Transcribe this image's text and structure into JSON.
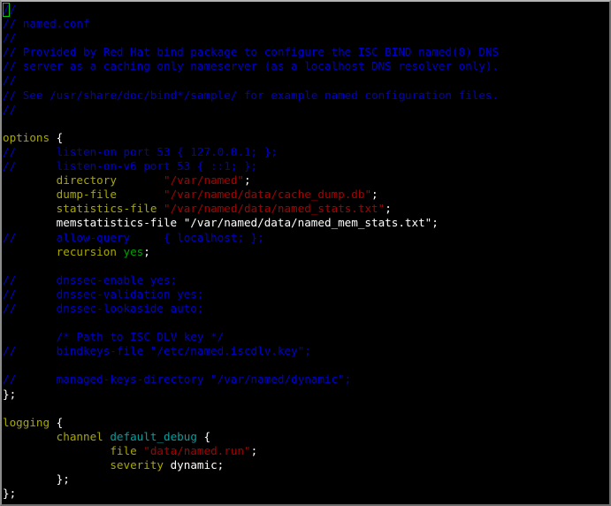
{
  "window": {
    "app": "terminal",
    "background_color": "#000000",
    "border_color": "#b4b4b4"
  },
  "editor": {
    "filename": "named.conf",
    "mode": "normal",
    "cursor": {
      "line": 1,
      "column": 1,
      "char": "/",
      "color": "#00cc00"
    },
    "palette": {
      "plain": "#ffffff",
      "comment": "#0000cc",
      "keyword": "#a8a800",
      "string": "#a80000",
      "identifier": "#00a0a0",
      "value": "#00a000"
    }
  },
  "lines": [
    {
      "id": 1,
      "text": "//",
      "tokens": [
        {
          "t": "//",
          "c": "comment",
          "cursor": true
        }
      ]
    },
    {
      "id": 2,
      "text": "// named.conf",
      "tokens": [
        {
          "t": "// named.conf",
          "c": "comment"
        }
      ]
    },
    {
      "id": 3,
      "text": "//",
      "tokens": [
        {
          "t": "//",
          "c": "comment"
        }
      ]
    },
    {
      "id": 4,
      "text": "// Provided by Red Hat bind package to configure the ISC BIND named(8) DNS",
      "tokens": [
        {
          "t": "// Provided by Red Hat bind package to configure the ISC BIND named(8) DNS",
          "c": "comment"
        }
      ]
    },
    {
      "id": 5,
      "text": "// server as a caching only nameserver (as a localhost DNS resolver only).",
      "tokens": [
        {
          "t": "// server as a caching only nameserver (as a localhost DNS resolver only).",
          "c": "comment"
        }
      ]
    },
    {
      "id": 6,
      "text": "//",
      "tokens": [
        {
          "t": "//",
          "c": "comment"
        }
      ]
    },
    {
      "id": 7,
      "text": "// See /usr/share/doc/bind*/sample/ for example named configuration files.",
      "tokens": [
        {
          "t": "// See /usr/share/doc/bind*/sample/ for example named configuration files.",
          "c": "comment"
        }
      ]
    },
    {
      "id": 8,
      "text": "//",
      "tokens": [
        {
          "t": "//",
          "c": "comment"
        }
      ]
    },
    {
      "id": 9,
      "text": "",
      "tokens": []
    },
    {
      "id": 10,
      "text": "options {",
      "tokens": [
        {
          "t": "options",
          "c": "keyword"
        },
        {
          "t": " {",
          "c": "plain"
        }
      ]
    },
    {
      "id": 11,
      "text": "//\tlisten-on port 53 { 127.0.0.1; };",
      "tokens": [
        {
          "t": "//      listen-on port 53 { 127.0.0.1; };",
          "c": "comment"
        }
      ]
    },
    {
      "id": 12,
      "text": "//\tlisten-on-v6 port 53 { ::1; };",
      "tokens": [
        {
          "t": "//      listen-on-v6 port 53 { ::1; };",
          "c": "comment"
        }
      ]
    },
    {
      "id": 13,
      "text": "\tdirectory\t\"/var/named\";",
      "tokens": [
        {
          "t": "        ",
          "c": "plain"
        },
        {
          "t": "directory",
          "c": "keyword"
        },
        {
          "t": "       ",
          "c": "plain"
        },
        {
          "t": "\"/var/named\"",
          "c": "string"
        },
        {
          "t": ";",
          "c": "plain"
        }
      ]
    },
    {
      "id": 14,
      "text": "\tdump-file\t\"/var/named/data/cache_dump.db\";",
      "tokens": [
        {
          "t": "        ",
          "c": "plain"
        },
        {
          "t": "dump-file",
          "c": "keyword"
        },
        {
          "t": "       ",
          "c": "plain"
        },
        {
          "t": "\"/var/named/data/cache_dump.db\"",
          "c": "string"
        },
        {
          "t": ";",
          "c": "plain"
        }
      ]
    },
    {
      "id": 15,
      "text": "\tstatistics-file \"/var/named/data/named_stats.txt\";",
      "tokens": [
        {
          "t": "        ",
          "c": "plain"
        },
        {
          "t": "statistics-file",
          "c": "keyword"
        },
        {
          "t": " ",
          "c": "plain"
        },
        {
          "t": "\"/var/named/data/named_stats.txt\"",
          "c": "string"
        },
        {
          "t": ";",
          "c": "plain"
        }
      ]
    },
    {
      "id": 16,
      "text": "\tmemstatistics-file \"/var/named/data/named_mem_stats.txt\";",
      "tokens": [
        {
          "t": "        memstatistics-file \"/var/named/data/named_mem_stats.txt\";",
          "c": "plain"
        }
      ]
    },
    {
      "id": 17,
      "text": "//\tallow-query     { localhost; };",
      "tokens": [
        {
          "t": "//      allow-query     { localhost; };",
          "c": "comment"
        }
      ]
    },
    {
      "id": 18,
      "text": "\trecursion yes;",
      "tokens": [
        {
          "t": "        ",
          "c": "plain"
        },
        {
          "t": "recursion",
          "c": "keyword"
        },
        {
          "t": " ",
          "c": "plain"
        },
        {
          "t": "yes",
          "c": "value"
        },
        {
          "t": ";",
          "c": "plain"
        }
      ]
    },
    {
      "id": 19,
      "text": "",
      "tokens": []
    },
    {
      "id": 20,
      "text": "//\tdnssec-enable yes;",
      "tokens": [
        {
          "t": "//      dnssec-enable yes;",
          "c": "comment"
        }
      ]
    },
    {
      "id": 21,
      "text": "//\tdnssec-validation yes;",
      "tokens": [
        {
          "t": "//      dnssec-validation yes;",
          "c": "comment"
        }
      ]
    },
    {
      "id": 22,
      "text": "//\tdnssec-lookaside auto;",
      "tokens": [
        {
          "t": "//      dnssec-lookaside auto;",
          "c": "comment"
        }
      ]
    },
    {
      "id": 23,
      "text": "",
      "tokens": []
    },
    {
      "id": 24,
      "text": "\t/* Path to ISC DLV key */",
      "tokens": [
        {
          "t": "        ",
          "c": "plain"
        },
        {
          "t": "/* Path to ISC DLV key */",
          "c": "comment"
        }
      ]
    },
    {
      "id": 25,
      "text": "//\tbindkeys-file \"/etc/named.iscdlv.key\";",
      "tokens": [
        {
          "t": "//      bindkeys-file \"/etc/named.iscdlv.key\";",
          "c": "comment"
        }
      ]
    },
    {
      "id": 26,
      "text": "",
      "tokens": []
    },
    {
      "id": 27,
      "text": "//\tmanaged-keys-directory \"/var/named/dynamic\";",
      "tokens": [
        {
          "t": "//      managed-keys-directory \"/var/named/dynamic\";",
          "c": "comment"
        }
      ]
    },
    {
      "id": 28,
      "text": "};",
      "tokens": [
        {
          "t": "};",
          "c": "plain"
        }
      ]
    },
    {
      "id": 29,
      "text": "",
      "tokens": []
    },
    {
      "id": 30,
      "text": "logging {",
      "tokens": [
        {
          "t": "logging",
          "c": "keyword"
        },
        {
          "t": " {",
          "c": "plain"
        }
      ]
    },
    {
      "id": 31,
      "text": "\tchannel default_debug {",
      "tokens": [
        {
          "t": "        ",
          "c": "plain"
        },
        {
          "t": "channel",
          "c": "keyword"
        },
        {
          "t": " ",
          "c": "plain"
        },
        {
          "t": "default_debug",
          "c": "ident"
        },
        {
          "t": " {",
          "c": "plain"
        }
      ]
    },
    {
      "id": 32,
      "text": "\t\tfile \"data/named.run\";",
      "tokens": [
        {
          "t": "                ",
          "c": "plain"
        },
        {
          "t": "file",
          "c": "keyword"
        },
        {
          "t": " ",
          "c": "plain"
        },
        {
          "t": "\"data/named.run\"",
          "c": "string"
        },
        {
          "t": ";",
          "c": "plain"
        }
      ]
    },
    {
      "id": 33,
      "text": "\t\tseverity dynamic;",
      "tokens": [
        {
          "t": "                ",
          "c": "plain"
        },
        {
          "t": "severity",
          "c": "keyword"
        },
        {
          "t": " ",
          "c": "plain"
        },
        {
          "t": "dynamic;",
          "c": "plain"
        }
      ]
    },
    {
      "id": 34,
      "text": "\t};",
      "tokens": [
        {
          "t": "        };",
          "c": "plain"
        }
      ]
    },
    {
      "id": 35,
      "text": "};",
      "tokens": [
        {
          "t": "};",
          "c": "plain"
        }
      ]
    }
  ]
}
